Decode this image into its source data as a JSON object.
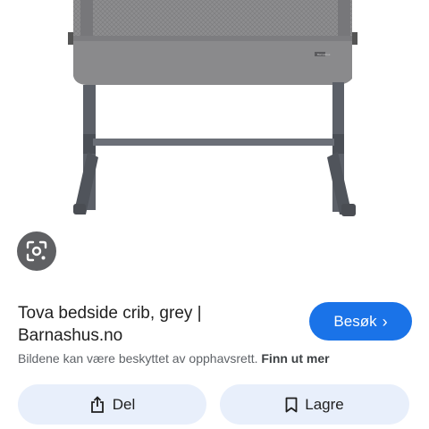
{
  "product": {
    "title_line1": "Tova bedside crib, grey |",
    "title_line2": "Barnashus.no",
    "image_logo_text": "Barnashus"
  },
  "actions": {
    "visit_label": "Besøk",
    "share_label": "Del",
    "save_label": "Lagre"
  },
  "notice": {
    "text": "Bildene kan være beskyttet av opphavsrett.",
    "link": "Finn ut mer"
  },
  "icons": {
    "lens": "lens-search-icon",
    "visit": "chevron-right-icon",
    "share": "share-icon",
    "save": "bookmark-icon"
  },
  "colors": {
    "accent": "#1a73e8",
    "pill_bg": "#e8effb",
    "lens_bg": "#5f6063",
    "fabric": "#8a8a8c"
  }
}
